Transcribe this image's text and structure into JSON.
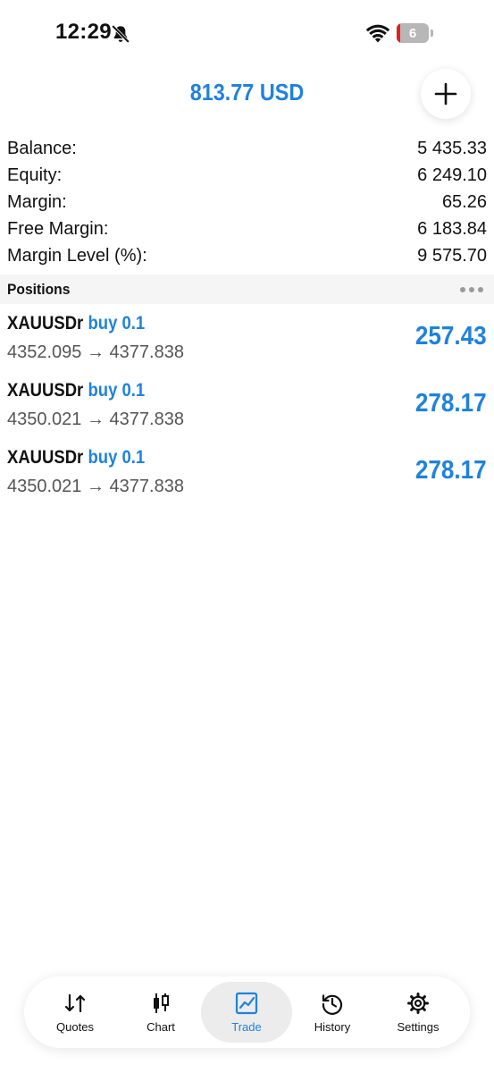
{
  "status_bar": {
    "time": "12:29",
    "battery": "6"
  },
  "header": {
    "title": "813.77 USD"
  },
  "summary": [
    {
      "label": "Balance:",
      "value": "5 435.33"
    },
    {
      "label": "Equity:",
      "value": "6 249.10"
    },
    {
      "label": "Margin:",
      "value": "65.26"
    },
    {
      "label": "Free Margin:",
      "value": "6 183.84"
    },
    {
      "label": "Margin Level (%):",
      "value": "9 575.70"
    }
  ],
  "positions_section": {
    "title": "Positions"
  },
  "positions": [
    {
      "symbol": "XAUUSDr",
      "side": "buy 0.1",
      "prices": "4352.095 → 4377.838",
      "profit": "257.43"
    },
    {
      "symbol": "XAUUSDr",
      "side": "buy 0.1",
      "prices": "4350.021 → 4377.838",
      "profit": "278.17"
    },
    {
      "symbol": "XAUUSDr",
      "side": "buy 0.1",
      "prices": "4350.021 → 4377.838",
      "profit": "278.17"
    }
  ],
  "tabs": [
    {
      "label": "Quotes",
      "icon": "quotes-icon"
    },
    {
      "label": "Chart",
      "icon": "candlestick-icon"
    },
    {
      "label": "Trade",
      "icon": "trade-icon"
    },
    {
      "label": "History",
      "icon": "history-icon"
    },
    {
      "label": "Settings",
      "icon": "gear-icon"
    }
  ],
  "colors": {
    "accent": "#1f82db",
    "text": "#111111",
    "muted": "#555555",
    "section_bg": "#f5f5f5"
  }
}
